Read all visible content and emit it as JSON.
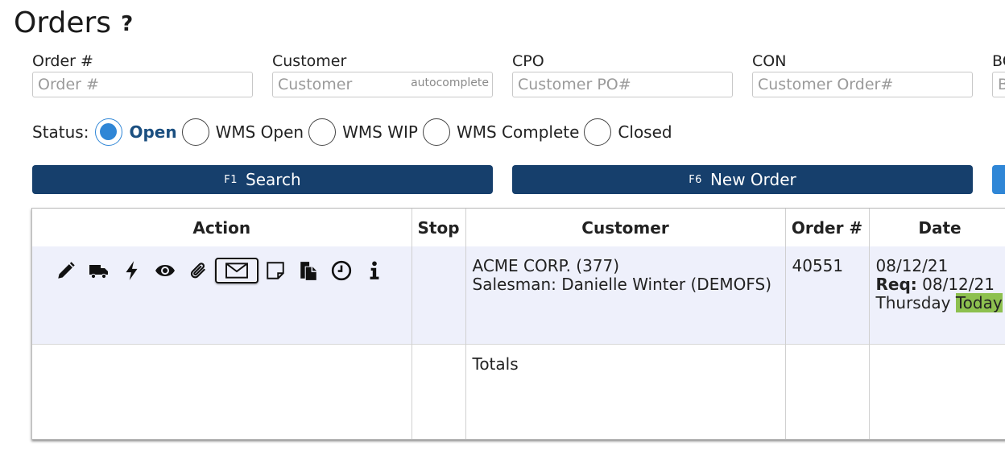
{
  "page": {
    "title": "Orders",
    "help_icon": "?"
  },
  "filters": {
    "order": {
      "label": "Order #",
      "placeholder": "Order #",
      "value": ""
    },
    "customer": {
      "label": "Customer",
      "placeholder": "Customer",
      "hint": "autocomplete",
      "value": ""
    },
    "cpo": {
      "label": "CPO",
      "placeholder": "Customer PO#",
      "value": ""
    },
    "con": {
      "label": "CON",
      "placeholder": "Customer Order#",
      "value": ""
    },
    "bo": {
      "label": "BO",
      "placeholder": "B",
      "value": ""
    }
  },
  "status": {
    "label": "Status:",
    "selected": "Open",
    "options": [
      "Open",
      "WMS Open",
      "WMS WIP",
      "WMS Complete",
      "Closed"
    ]
  },
  "buttons": {
    "search": {
      "key": "F1",
      "label": "Search"
    },
    "new_order": {
      "key": "F6",
      "label": "New Order"
    }
  },
  "grid": {
    "headers": {
      "action": "Action",
      "stop": "Stop",
      "customer": "Customer",
      "order": "Order #",
      "date": "Date"
    },
    "row": {
      "actions": [
        "pencil-icon",
        "truck-icon",
        "lightning-icon",
        "eye-icon",
        "paperclip-icon",
        "envelope-icon",
        "note-icon",
        "paste-icon",
        "clock-icon",
        "info-icon"
      ],
      "stop": "",
      "customer_name": "ACME CORP. (377)",
      "salesman": "Salesman: Danielle Winter (DEMOFS)",
      "order_number": "40551",
      "date": "08/12/21",
      "req_label": "Req:",
      "req_date": "08/12/21",
      "weekday": "Thursday",
      "today_badge": "Today"
    },
    "totals_label": "Totals"
  },
  "colors": {
    "primary_button": "#163f6c",
    "radio_selected": "#2f86d6",
    "row_background": "#eef0fb",
    "today_highlight": "#8dc04f"
  }
}
